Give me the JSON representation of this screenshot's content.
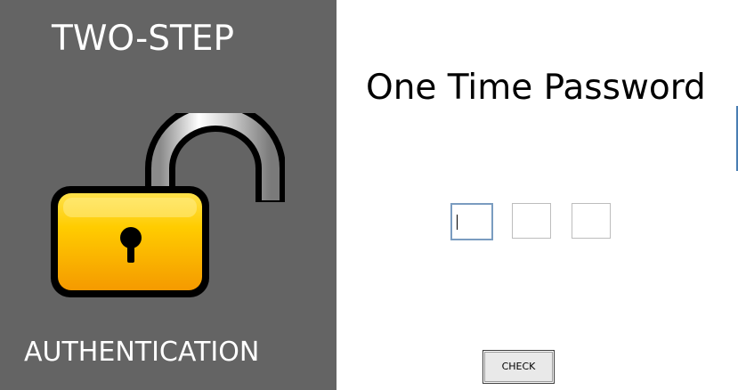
{
  "left_panel": {
    "brand_line1": "TWO-STEP",
    "brand_line2": "AUTHENTICATION",
    "icon": "open-padlock-icon"
  },
  "main": {
    "title": "One Time Password",
    "otp_fields": [
      {
        "value": "",
        "focused": true
      },
      {
        "value": "",
        "focused": false
      },
      {
        "value": "",
        "focused": false
      }
    ],
    "check_label": "CHECK"
  },
  "colors": {
    "left_panel_bg": "#646464",
    "lock_body": "#f5b800",
    "accent": "#4a7eb3"
  }
}
